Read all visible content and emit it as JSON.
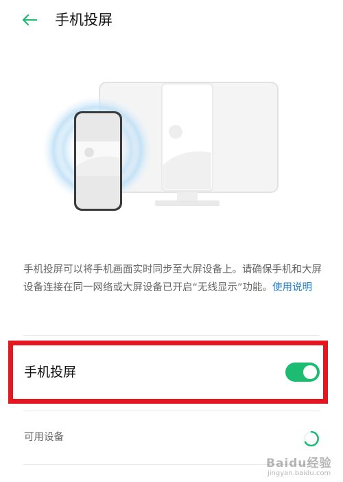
{
  "header": {
    "title": "手机投屏",
    "back_icon": "arrow-left-icon"
  },
  "description": {
    "text": "手机投屏可以将手机画面实时同步至大屏设备上。请确保手机和大屏设备连接在同一网络或大屏设备已开启“无线显示”功能。",
    "help_link": "使用说明"
  },
  "setting": {
    "label": "手机投屏",
    "toggle_on": true
  },
  "available_devices": {
    "label": "可用设备",
    "status": "loading"
  },
  "colors": {
    "accent": "#1ebc73",
    "highlight": "#e5161f",
    "link": "#1f7fc8"
  },
  "watermark": {
    "text": "Baidu经验",
    "sub": "jingyan.baidu.com"
  }
}
